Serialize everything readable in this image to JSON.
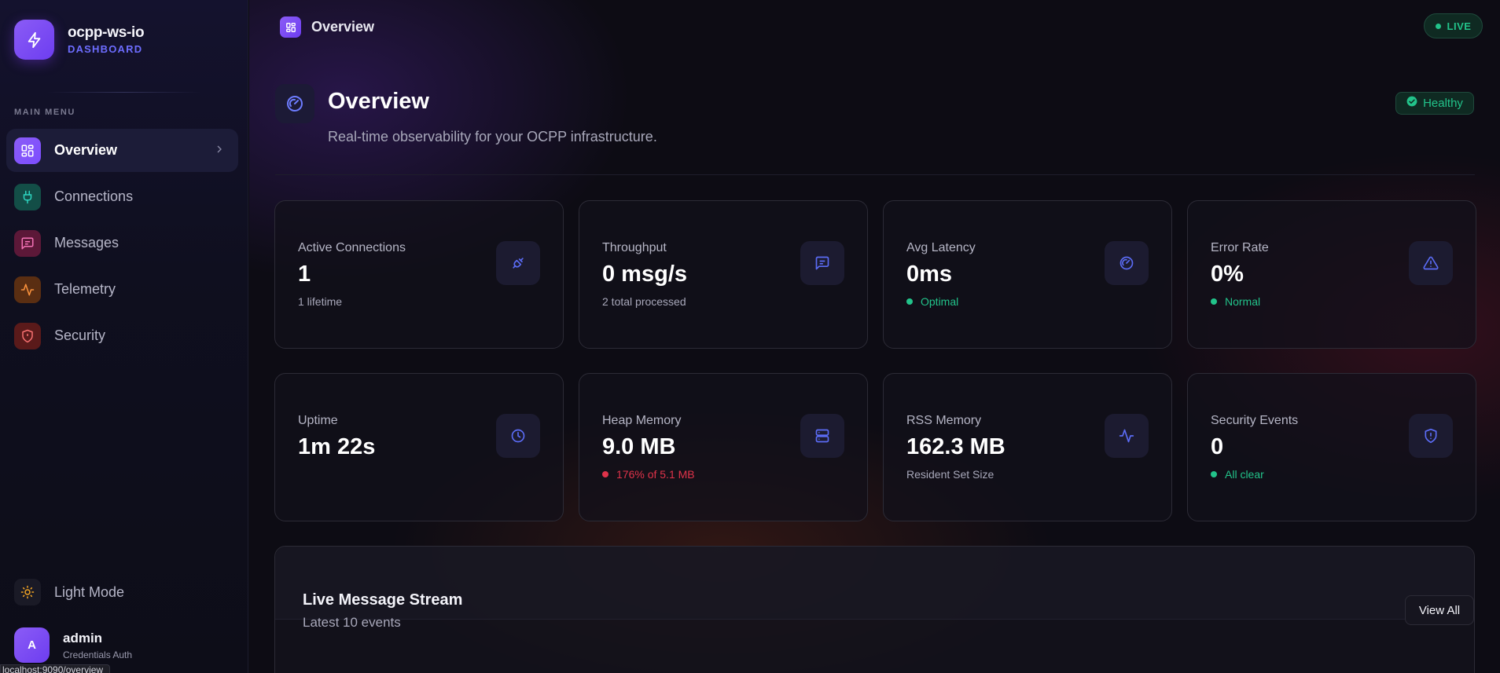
{
  "brand": {
    "name": "ocpp-ws-io",
    "subtitle": "DASHBOARD"
  },
  "sidebar": {
    "menu_label": "MAIN MENU",
    "items": [
      {
        "label": "Overview",
        "icon": "layout-dashboard-icon",
        "active": true,
        "color": "#8b5cf6"
      },
      {
        "label": "Connections",
        "icon": "plug-icon",
        "active": false,
        "color": "#14b8a6"
      },
      {
        "label": "Messages",
        "icon": "message-square-icon",
        "active": false,
        "color": "#ec4899"
      },
      {
        "label": "Telemetry",
        "icon": "activity-icon",
        "active": false,
        "color": "#f97316"
      },
      {
        "label": "Security",
        "icon": "shield-icon",
        "active": false,
        "color": "#ef4444"
      }
    ],
    "light_mode_label": "Light Mode",
    "user": {
      "initial": "A",
      "name": "admin",
      "auth": "Credentials Auth"
    },
    "status_url": "localhost:9090/overview"
  },
  "topbar": {
    "title": "Overview",
    "live_label": "LIVE"
  },
  "header": {
    "title": "Overview",
    "subtitle": "Real-time observability for your OCPP infrastructure.",
    "health_label": "Healthy"
  },
  "stats": [
    {
      "label": "Active Connections",
      "value": "1",
      "sub": "1 lifetime",
      "sub_status": "none",
      "icon": "plug-icon"
    },
    {
      "label": "Throughput",
      "value": "0 msg/s",
      "sub": "2 total processed",
      "sub_status": "none",
      "icon": "message-square-icon"
    },
    {
      "label": "Avg Latency",
      "value": "0ms",
      "sub": "Optimal",
      "sub_status": "good",
      "icon": "gauge-icon"
    },
    {
      "label": "Error Rate",
      "value": "0%",
      "sub": "Normal",
      "sub_status": "good",
      "icon": "alert-triangle-icon"
    },
    {
      "label": "Uptime",
      "value": "1m 22s",
      "sub": "",
      "sub_status": "none",
      "icon": "clock-icon"
    },
    {
      "label": "Heap Memory",
      "value": "9.0 MB",
      "sub": "176% of 5.1 MB",
      "sub_status": "bad",
      "icon": "server-icon"
    },
    {
      "label": "RSS Memory",
      "value": "162.3 MB",
      "sub": "Resident Set Size",
      "sub_status": "none",
      "icon": "activity-icon"
    },
    {
      "label": "Security Events",
      "value": "0",
      "sub": "All clear",
      "sub_status": "good",
      "icon": "shield-alert-icon"
    }
  ],
  "stream": {
    "title": "Live Message Stream",
    "subtitle": "Latest 10 events",
    "view_all_label": "View All"
  },
  "colors": {
    "accent": "#8b5cf6",
    "success": "#22c38a",
    "danger": "#ef4444",
    "icon_blue": "#5b6cf5"
  }
}
